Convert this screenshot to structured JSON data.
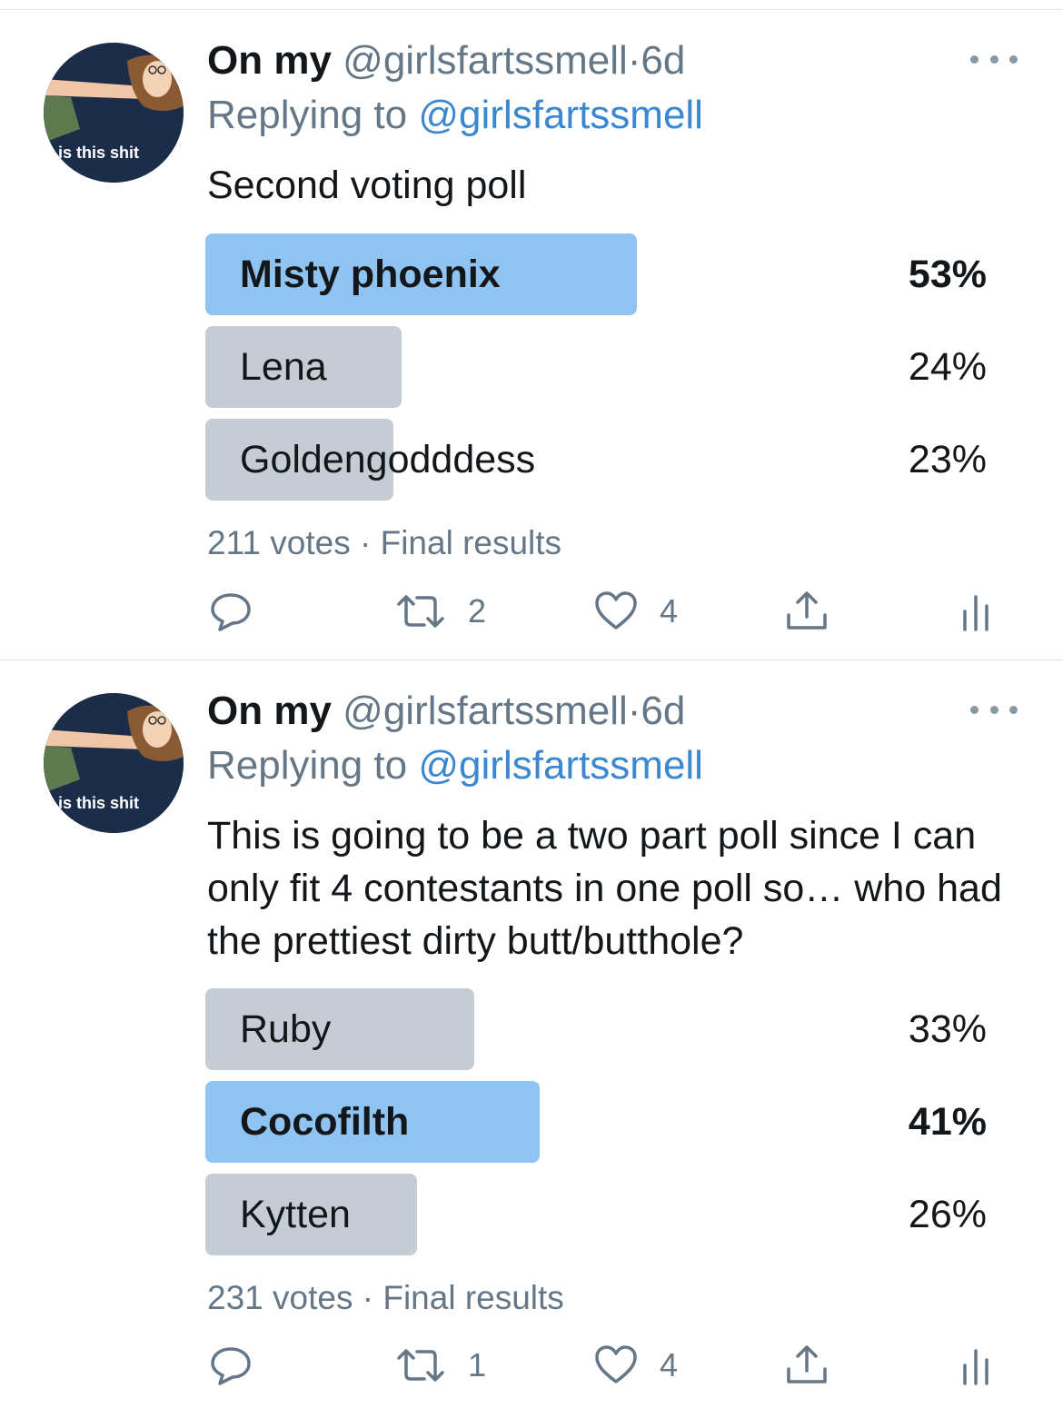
{
  "tweets": [
    {
      "avatar_caption": "is this shit",
      "display_name": "On my",
      "handle": "@girlsfartssmell",
      "time": "6d",
      "replying_label": "Replying to",
      "replying_handle": "@girlsfartssmell",
      "text": "Second voting poll",
      "poll": {
        "options": [
          {
            "label": "Misty phoenix",
            "percent_text": "53%",
            "percent": 53,
            "winner": true
          },
          {
            "label": "Lena",
            "percent_text": "24%",
            "percent": 24,
            "winner": false
          },
          {
            "label": "Goldengodddess",
            "percent_text": "23%",
            "percent": 23,
            "winner": false
          }
        ],
        "votes": "211 votes",
        "status": "Final results"
      },
      "actions": {
        "retweets": "2",
        "likes": "4"
      }
    },
    {
      "avatar_caption": "is this shit",
      "display_name": "On my",
      "handle": "@girlsfartssmell",
      "time": "6d",
      "replying_label": "Replying to",
      "replying_handle": "@girlsfartssmell",
      "text": "This is going to be a two part poll since I can only fit 4 contestants in one poll so… who had the prettiest dirty butt/butthole?",
      "poll": {
        "options": [
          {
            "label": "Ruby",
            "percent_text": "33%",
            "percent": 33,
            "winner": false
          },
          {
            "label": "Cocofilth",
            "percent_text": "41%",
            "percent": 41,
            "winner": true
          },
          {
            "label": "Kytten",
            "percent_text": "26%",
            "percent": 26,
            "winner": false
          }
        ],
        "votes": "231 votes",
        "status": "Final results"
      },
      "actions": {
        "retweets": "1",
        "likes": "4"
      }
    }
  ],
  "colors": {
    "winner_bar": "#8fc4f2",
    "bar": "#c5ccd3",
    "link": "#3b88d0",
    "secondary_text": "#657786"
  },
  "icons": [
    "reply-icon",
    "retweet-icon",
    "like-icon",
    "share-icon",
    "analytics-icon",
    "more-icon"
  ]
}
